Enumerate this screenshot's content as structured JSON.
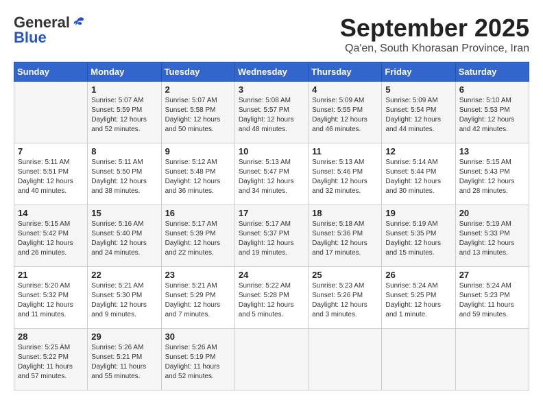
{
  "header": {
    "logo_general": "General",
    "logo_blue": "Blue",
    "month": "September 2025",
    "location": "Qa'en, South Khorasan Province, Iran"
  },
  "weekdays": [
    "Sunday",
    "Monday",
    "Tuesday",
    "Wednesday",
    "Thursday",
    "Friday",
    "Saturday"
  ],
  "weeks": [
    [
      {
        "day": "",
        "info": ""
      },
      {
        "day": "1",
        "info": "Sunrise: 5:07 AM\nSunset: 5:59 PM\nDaylight: 12 hours\nand 52 minutes."
      },
      {
        "day": "2",
        "info": "Sunrise: 5:07 AM\nSunset: 5:58 PM\nDaylight: 12 hours\nand 50 minutes."
      },
      {
        "day": "3",
        "info": "Sunrise: 5:08 AM\nSunset: 5:57 PM\nDaylight: 12 hours\nand 48 minutes."
      },
      {
        "day": "4",
        "info": "Sunrise: 5:09 AM\nSunset: 5:55 PM\nDaylight: 12 hours\nand 46 minutes."
      },
      {
        "day": "5",
        "info": "Sunrise: 5:09 AM\nSunset: 5:54 PM\nDaylight: 12 hours\nand 44 minutes."
      },
      {
        "day": "6",
        "info": "Sunrise: 5:10 AM\nSunset: 5:53 PM\nDaylight: 12 hours\nand 42 minutes."
      }
    ],
    [
      {
        "day": "7",
        "info": "Sunrise: 5:11 AM\nSunset: 5:51 PM\nDaylight: 12 hours\nand 40 minutes."
      },
      {
        "day": "8",
        "info": "Sunrise: 5:11 AM\nSunset: 5:50 PM\nDaylight: 12 hours\nand 38 minutes."
      },
      {
        "day": "9",
        "info": "Sunrise: 5:12 AM\nSunset: 5:48 PM\nDaylight: 12 hours\nand 36 minutes."
      },
      {
        "day": "10",
        "info": "Sunrise: 5:13 AM\nSunset: 5:47 PM\nDaylight: 12 hours\nand 34 minutes."
      },
      {
        "day": "11",
        "info": "Sunrise: 5:13 AM\nSunset: 5:46 PM\nDaylight: 12 hours\nand 32 minutes."
      },
      {
        "day": "12",
        "info": "Sunrise: 5:14 AM\nSunset: 5:44 PM\nDaylight: 12 hours\nand 30 minutes."
      },
      {
        "day": "13",
        "info": "Sunrise: 5:15 AM\nSunset: 5:43 PM\nDaylight: 12 hours\nand 28 minutes."
      }
    ],
    [
      {
        "day": "14",
        "info": "Sunrise: 5:15 AM\nSunset: 5:42 PM\nDaylight: 12 hours\nand 26 minutes."
      },
      {
        "day": "15",
        "info": "Sunrise: 5:16 AM\nSunset: 5:40 PM\nDaylight: 12 hours\nand 24 minutes."
      },
      {
        "day": "16",
        "info": "Sunrise: 5:17 AM\nSunset: 5:39 PM\nDaylight: 12 hours\nand 22 minutes."
      },
      {
        "day": "17",
        "info": "Sunrise: 5:17 AM\nSunset: 5:37 PM\nDaylight: 12 hours\nand 19 minutes."
      },
      {
        "day": "18",
        "info": "Sunrise: 5:18 AM\nSunset: 5:36 PM\nDaylight: 12 hours\nand 17 minutes."
      },
      {
        "day": "19",
        "info": "Sunrise: 5:19 AM\nSunset: 5:35 PM\nDaylight: 12 hours\nand 15 minutes."
      },
      {
        "day": "20",
        "info": "Sunrise: 5:19 AM\nSunset: 5:33 PM\nDaylight: 12 hours\nand 13 minutes."
      }
    ],
    [
      {
        "day": "21",
        "info": "Sunrise: 5:20 AM\nSunset: 5:32 PM\nDaylight: 12 hours\nand 11 minutes."
      },
      {
        "day": "22",
        "info": "Sunrise: 5:21 AM\nSunset: 5:30 PM\nDaylight: 12 hours\nand 9 minutes."
      },
      {
        "day": "23",
        "info": "Sunrise: 5:21 AM\nSunset: 5:29 PM\nDaylight: 12 hours\nand 7 minutes."
      },
      {
        "day": "24",
        "info": "Sunrise: 5:22 AM\nSunset: 5:28 PM\nDaylight: 12 hours\nand 5 minutes."
      },
      {
        "day": "25",
        "info": "Sunrise: 5:23 AM\nSunset: 5:26 PM\nDaylight: 12 hours\nand 3 minutes."
      },
      {
        "day": "26",
        "info": "Sunrise: 5:24 AM\nSunset: 5:25 PM\nDaylight: 12 hours\nand 1 minute."
      },
      {
        "day": "27",
        "info": "Sunrise: 5:24 AM\nSunset: 5:23 PM\nDaylight: 11 hours\nand 59 minutes."
      }
    ],
    [
      {
        "day": "28",
        "info": "Sunrise: 5:25 AM\nSunset: 5:22 PM\nDaylight: 11 hours\nand 57 minutes."
      },
      {
        "day": "29",
        "info": "Sunrise: 5:26 AM\nSunset: 5:21 PM\nDaylight: 11 hours\nand 55 minutes."
      },
      {
        "day": "30",
        "info": "Sunrise: 5:26 AM\nSunset: 5:19 PM\nDaylight: 11 hours\nand 52 minutes."
      },
      {
        "day": "",
        "info": ""
      },
      {
        "day": "",
        "info": ""
      },
      {
        "day": "",
        "info": ""
      },
      {
        "day": "",
        "info": ""
      }
    ]
  ]
}
